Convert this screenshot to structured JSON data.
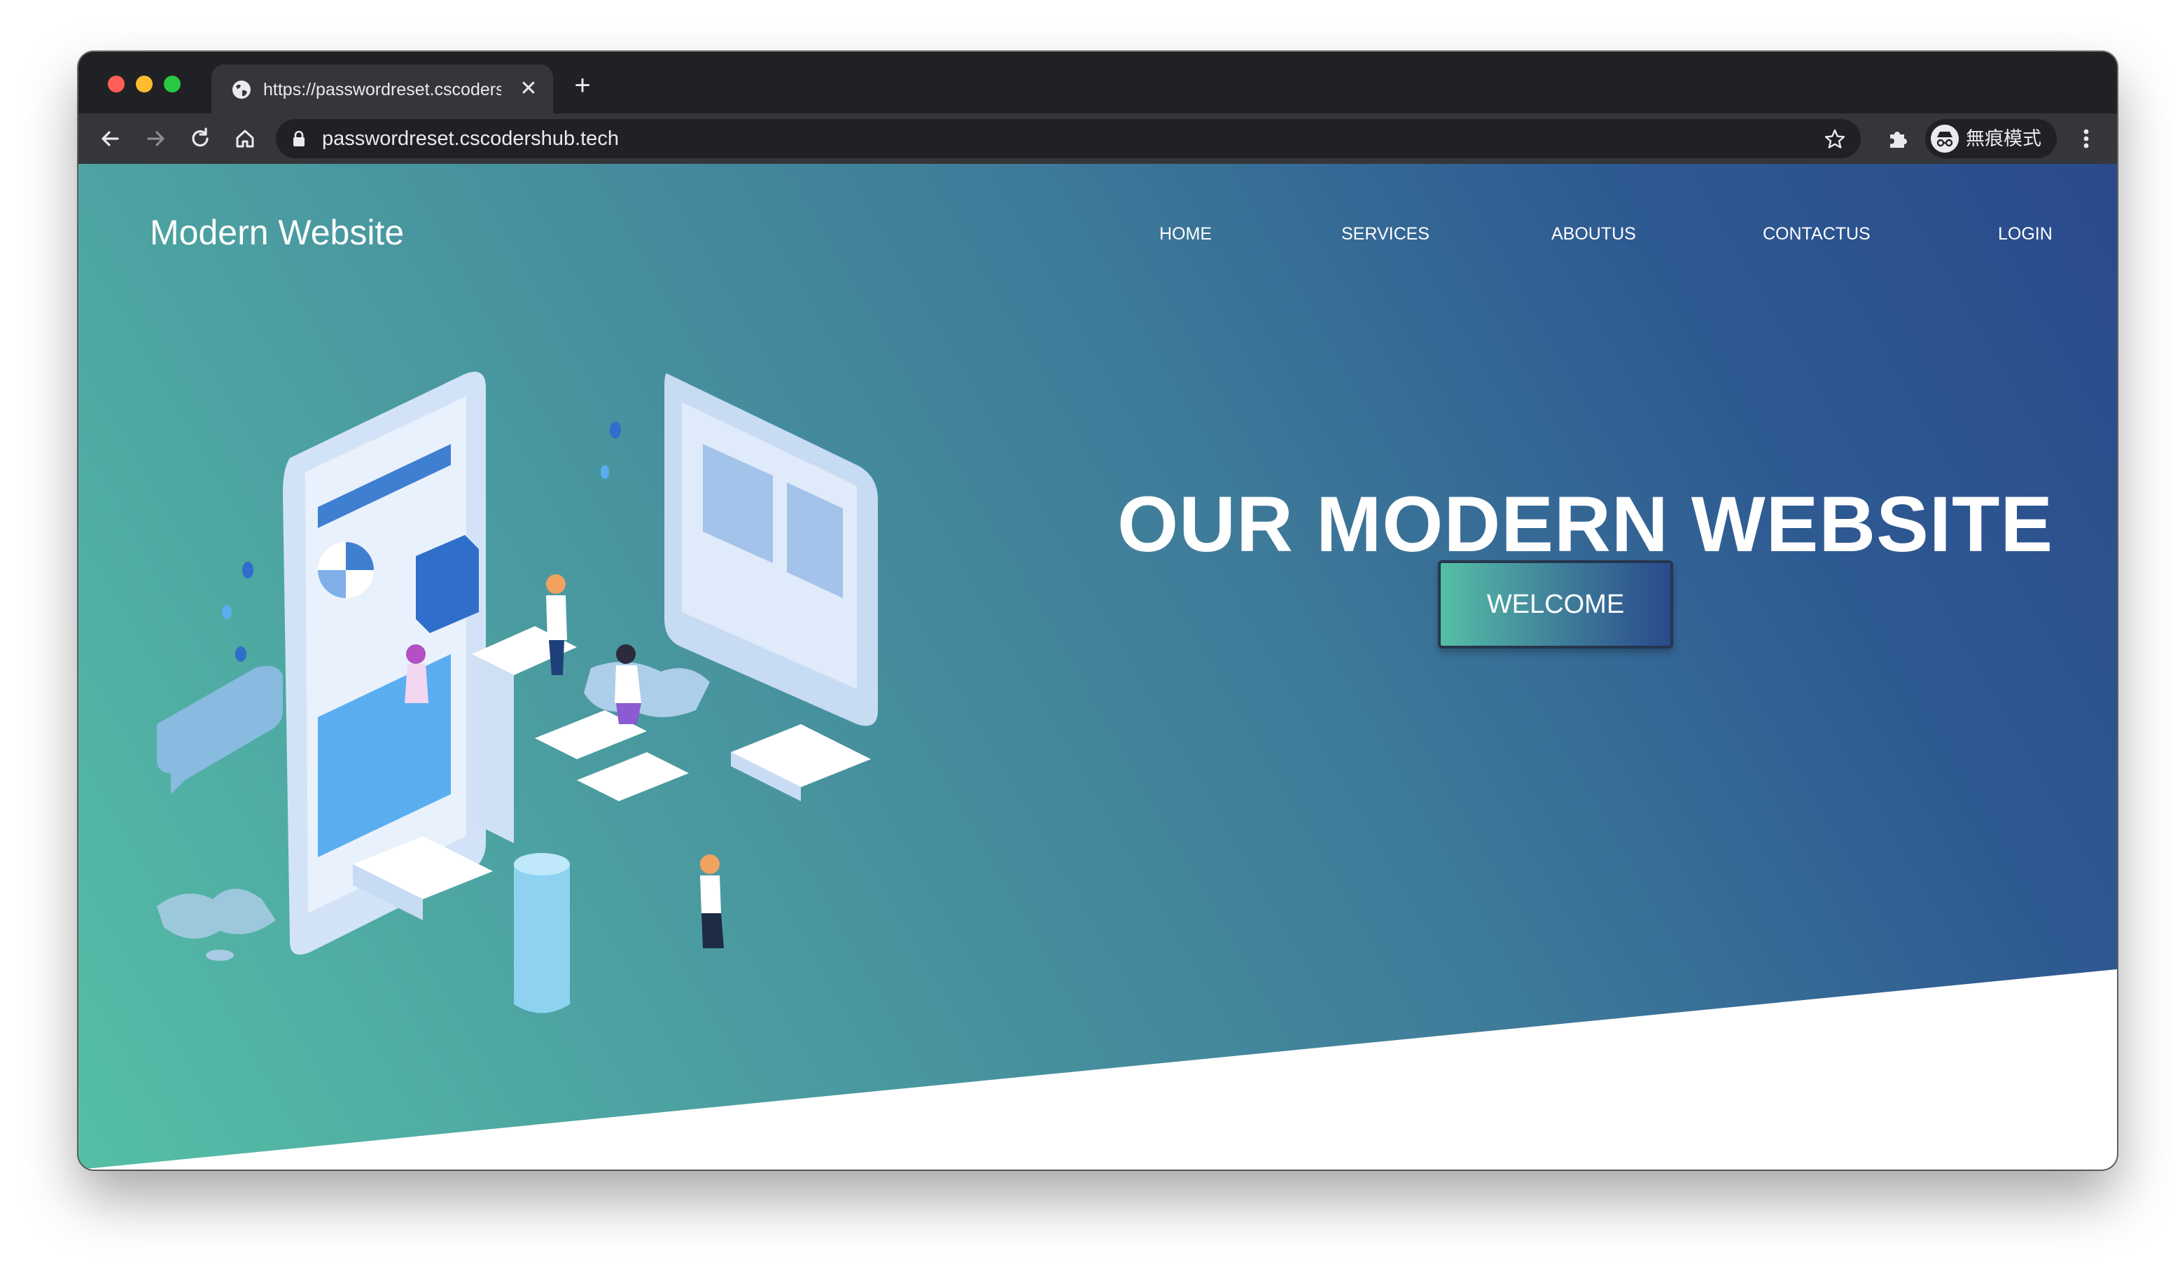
{
  "browser": {
    "tab_title": "https://passwordreset.cscoders",
    "url": "passwordreset.cscodershub.tech",
    "profile_label": "無痕模式",
    "tab_close_glyph": "✕",
    "new_tab_glyph": "+",
    "icons": [
      "globe-icon",
      "back-icon",
      "forward-icon",
      "reload-icon",
      "home-icon",
      "lock-icon",
      "star-icon",
      "extensions-icon",
      "incognito-icon",
      "menu-icon"
    ]
  },
  "site": {
    "brand": "Modern Website",
    "nav": [
      "HOME",
      "SERVICES",
      "ABOUTUS",
      "CONTACTUS",
      "LOGIN"
    ],
    "hero_title": "OUR MODERN WEBSITE",
    "cta_label": "WELCOME"
  },
  "colors": {
    "gradient_start": "#55bfa6",
    "gradient_end": "#2a4a8c",
    "button_border": "#26364e",
    "chrome_dark": "#202124",
    "chrome_toolbar": "#35363a"
  }
}
